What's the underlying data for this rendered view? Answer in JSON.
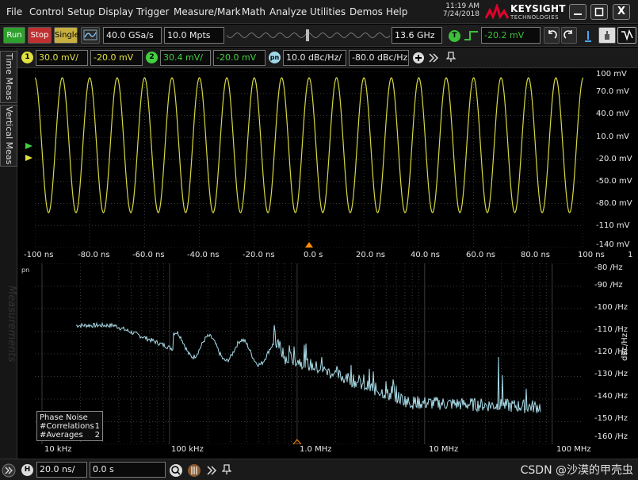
{
  "menu": [
    "File",
    "Control",
    "Setup",
    "Display",
    "Trigger",
    "Measure/Mark",
    "Math",
    "Analyze",
    "Utilities",
    "Demos",
    "Help"
  ],
  "clock": {
    "time": "11:19 AM",
    "date": "7/24/2018"
  },
  "brand": {
    "name": "KEYSIGHT",
    "sub": "TECHNOLOGIES",
    "color": "#e4002b"
  },
  "window_buttons": {
    "close": "X"
  },
  "toolbar": {
    "run": "Run",
    "stop": "Stop",
    "single": "Single",
    "sample_rate": "40.0 GSa/s",
    "memory_depth": "10.0 Mpts",
    "bandwidth": "13.6 GHz",
    "trigger_badge": "T",
    "trigger_level": "-20.2 mV"
  },
  "channels": [
    {
      "badge": "1",
      "scale": "30.0 mV/",
      "offset": "-20.0 mV",
      "color": "#e0e040"
    },
    {
      "badge": "2",
      "scale": "30.4 mV/",
      "offset": "-20.0 mV",
      "color": "#40d040"
    }
  ],
  "pn_channel": {
    "badge": "pn",
    "scale": "10.0 dBc/Hz/",
    "offset": "-80.0 dBc/Hz",
    "color": "#a0d8e8"
  },
  "side_tabs": {
    "time": "Time Meas",
    "vertical": "Vertical Meas",
    "watermark": "Measurements"
  },
  "time_axis": {
    "y_ticks": [
      "100 mV",
      "70.0 mV",
      "40.0 mV",
      "10.0 mV",
      "-20.0 mV",
      "-50.0 mV",
      "-80.0 mV",
      "-110 mV",
      "-140 mV"
    ],
    "x_ticks": [
      "-100 ns",
      "-80.0 ns",
      "-60.0 ns",
      "-40.0 ns",
      "-20.0 ns",
      "0.0 s",
      "20.0 ns",
      "40.0 ns",
      "60.0 ns",
      "80.0 ns",
      "100 ns"
    ],
    "edge_label": "1"
  },
  "wave_colors": {
    "ch1": "#d8d840",
    "grid": "#3a3a3a",
    "trigger": "#ff8c00",
    "pn": "#a8dce8"
  },
  "pn_axis": {
    "y_ticks": [
      "-80 /Hz",
      "-90 /Hz",
      "-100 /Hz",
      "-110 /Hz",
      "-120 /Hz",
      "-130 /Hz",
      "-140 /Hz",
      "-150 /Hz",
      "-160 /Hz"
    ],
    "x_ticks": [
      "10 kHz",
      "100 kHz",
      "1.0 MHz",
      "10 MHz",
      "100 MHz"
    ],
    "unit": "dBc/Hz",
    "corner_label": "pn"
  },
  "pn_box": {
    "title": "Phase Noise",
    "correlations_label": "#Correlations",
    "correlations": "1",
    "averages_label": "#Averages",
    "averages": "2"
  },
  "bottom": {
    "h_badge": "H",
    "h_scale": "20.0 ns/",
    "h_position": "0.0 s"
  },
  "watermark": "CSDN @沙漠的甲壳虫"
}
